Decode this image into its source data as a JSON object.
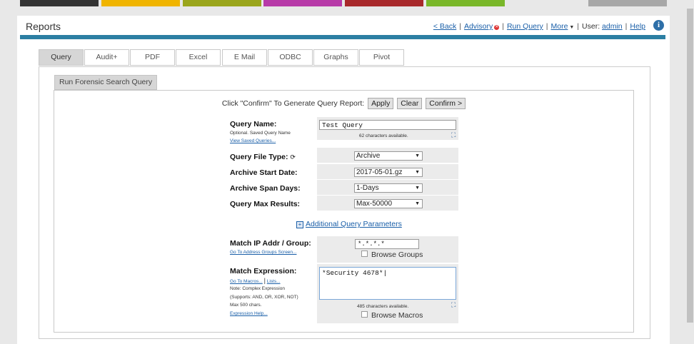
{
  "colorbar": [
    {
      "color": "#333333"
    },
    {
      "color": "#f0b400"
    },
    {
      "color": "#9aa51c"
    },
    {
      "color": "#b73aa8"
    },
    {
      "color": "#a8292b"
    },
    {
      "color": "#79b729"
    },
    {
      "color": "#a7a7a7"
    }
  ],
  "header": {
    "title": "Reports",
    "nav": {
      "back": "< Back",
      "advisory": "Advisory",
      "run_query": "Run Query",
      "more": "More",
      "user_label": "User:",
      "user": "admin",
      "help": "Help"
    },
    "info_icon": "i"
  },
  "tabs": [
    "Query",
    "Audit+",
    "PDF",
    "Excel",
    "E Mail",
    "ODBC",
    "Graphs",
    "Pivot"
  ],
  "subtab": "Run Forensic Search Query",
  "confirm": {
    "text": "Click \"Confirm\" To Generate Query Report:",
    "apply": "Apply",
    "clear": "Clear",
    "confirm": "Confirm >"
  },
  "form": {
    "query_name": {
      "label": "Query Name:",
      "note": "Optional. Saved Query Name",
      "link": "View Saved Queries...",
      "value": "Test Query",
      "chars": "62 characters available."
    },
    "file_type": {
      "label": "Query File Type:",
      "value": "Archive"
    },
    "start_date": {
      "label": "Archive Start Date:",
      "value": "2017-05-01.gz"
    },
    "span_days": {
      "label": "Archive Span Days:",
      "value": "1-Days"
    },
    "max_results": {
      "label": "Query Max Results:",
      "value": "Max-50000"
    },
    "additional": "Additional Query Parameters",
    "match_ip": {
      "label": "Match IP Addr / Group:",
      "link": "Go To Address Groups Screen...",
      "value": "*.*.*.*",
      "browse": "Browse Groups"
    },
    "match_expr": {
      "label": "Match Expression:",
      "link_macros": "Go To Macros...",
      "link_lists": "Lists...",
      "note1": "Note: Complex Expression",
      "note2": "(Supports: AND, OR, XOR, NOT)",
      "note3": "Max 500 chars.",
      "help": "Expression Help...",
      "value": "*Security 4678*",
      "chars": "485 characters available.",
      "browse": "Browse Macros"
    }
  }
}
